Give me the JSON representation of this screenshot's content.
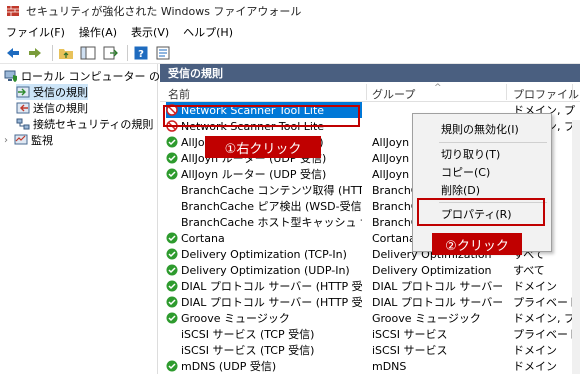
{
  "window": {
    "title": "セキュリティが強化された Windows ファイアウォール"
  },
  "menu": [
    "ファイル(F)",
    "操作(A)",
    "表示(V)",
    "ヘルプ(H)"
  ],
  "tree": {
    "root": "ローカル コンピューター のセキュリティ",
    "items": [
      "受信の規則",
      "送信の規則",
      "接続セキュリティの規則",
      "監視"
    ]
  },
  "panel": {
    "header": "受信の規則",
    "columns": {
      "name": "名前",
      "group": "グループ",
      "profile": "プロファイル"
    }
  },
  "rows": [
    {
      "name": "Network Scanner Tool Lite",
      "group": "",
      "profile": "",
      "status": "blocked"
    },
    {
      "name": "Network Scanner Tool Lite",
      "group": "",
      "profile": "",
      "status": "blocked"
    },
    {
      "name": "AllJoyn ルーター (TCP 受信)",
      "group": "AllJoyn ル",
      "profile": "",
      "status": "allowed"
    },
    {
      "name": "AllJoyn ルーター (UDP 受信)",
      "group": "AllJoyn ル",
      "profile": "",
      "status": "allowed"
    },
    {
      "name": "AllJoyn ルーター (UDP 受信)",
      "group": "AllJoyn ル",
      "profile": "",
      "status": "allowed"
    },
    {
      "name": "BranchCache コンテンツ取得 (HTTP-受信)",
      "group": "BranchCa",
      "profile": "",
      "status": "none"
    },
    {
      "name": "BranchCache ピア検出 (WSD-受信)",
      "group": "BranchCa",
      "profile": "",
      "status": "none"
    },
    {
      "name": "BranchCache ホスト型キャッシュ サーバー (HT...",
      "group": "BranchCa",
      "profile": "",
      "status": "none"
    },
    {
      "name": "Cortana",
      "group": "Cortana",
      "profile": "",
      "status": "allowed"
    },
    {
      "name": "Delivery Optimization (TCP-In)",
      "group": "Delivery Optimization",
      "profile": "すべて",
      "status": "allowed"
    },
    {
      "name": "Delivery Optimization (UDP-In)",
      "group": "Delivery Optimization",
      "profile": "すべて",
      "status": "allowed"
    },
    {
      "name": "DIAL プロトコル サーバー (HTTP 受信)",
      "group": "DIAL プロトコル サーバー",
      "profile": "ドメイン",
      "status": "allowed"
    },
    {
      "name": "DIAL プロトコル サーバー (HTTP 受信)",
      "group": "DIAL プロトコル サーバー",
      "profile": "プライベート",
      "status": "allowed"
    },
    {
      "name": "Groove ミュージック",
      "group": "Groove ミュージック",
      "profile": "ドメイン, プ",
      "status": "allowed"
    },
    {
      "name": "iSCSI サービス (TCP 受信)",
      "group": "iSCSI サービス",
      "profile": "プライベート,",
      "status": "none"
    },
    {
      "name": "iSCSI サービス (TCP 受信)",
      "group": "iSCSI サービス",
      "profile": "ドメイン",
      "status": "none"
    },
    {
      "name": "mDNS (UDP 受信)",
      "group": "mDNS",
      "profile": "ドメイン",
      "status": "allowed"
    }
  ],
  "selected_row_profile": "ドメイン, プ",
  "second_row_profile": "ドメイン, プ",
  "context_menu": [
    "規則の無効化(I)",
    "切り取り(T)",
    "コピー(C)",
    "削除(D)",
    "プロパティ(R)"
  ],
  "callouts": {
    "right_click": "①右クリック",
    "click": "②クリック"
  },
  "colors": {
    "callout": "#c00000",
    "selection": "#0078d7",
    "panel_header": "#4a5f80",
    "allowed": "#2e9b2e"
  }
}
